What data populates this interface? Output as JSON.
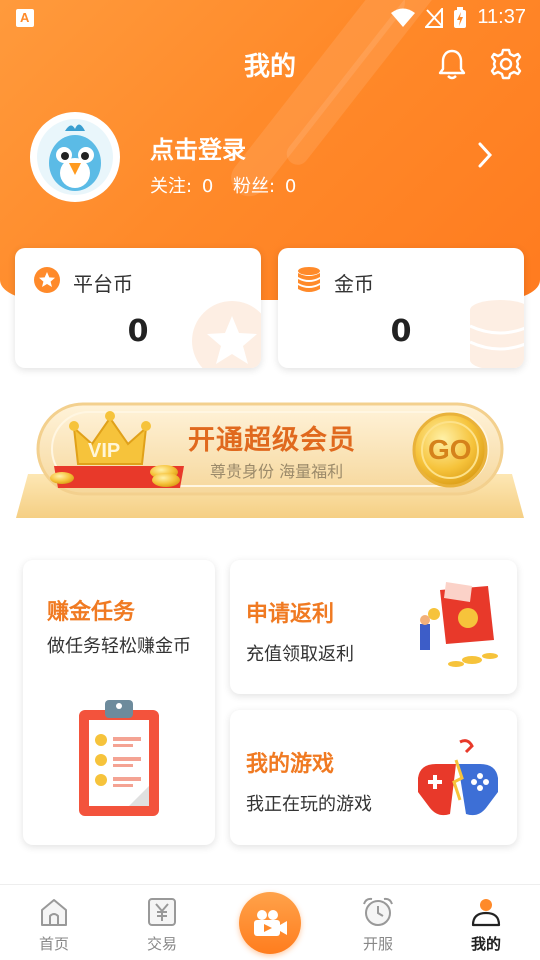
{
  "status_bar": {
    "time": "11:37"
  },
  "header": {
    "title": "我的"
  },
  "profile": {
    "login_text": "点击登录",
    "follow_label": "关注:",
    "follow_count": "0",
    "fans_label": "粉丝:",
    "fans_count": "0"
  },
  "wallet": {
    "platform_coin": {
      "label": "平台币",
      "value": "0"
    },
    "gold_coin": {
      "label": "金币",
      "value": "0"
    }
  },
  "vip_banner": {
    "title": "开通超级会员",
    "subtitle": "尊贵身份 海量福利",
    "badge": "VIP",
    "go_label": "GO"
  },
  "tasks": {
    "earn": {
      "title": "赚金任务",
      "subtitle": "做任务轻松赚金币"
    },
    "rebate": {
      "title": "申请返利",
      "subtitle": "充值领取返利"
    },
    "games": {
      "title": "我的游戏",
      "subtitle": "我正在玩的游戏"
    }
  },
  "tabbar": {
    "home": "首页",
    "trade": "交易",
    "servers": "开服",
    "mine": "我的"
  },
  "colors": {
    "accent": "#ff8a2a",
    "task_title": "#f07a22"
  }
}
